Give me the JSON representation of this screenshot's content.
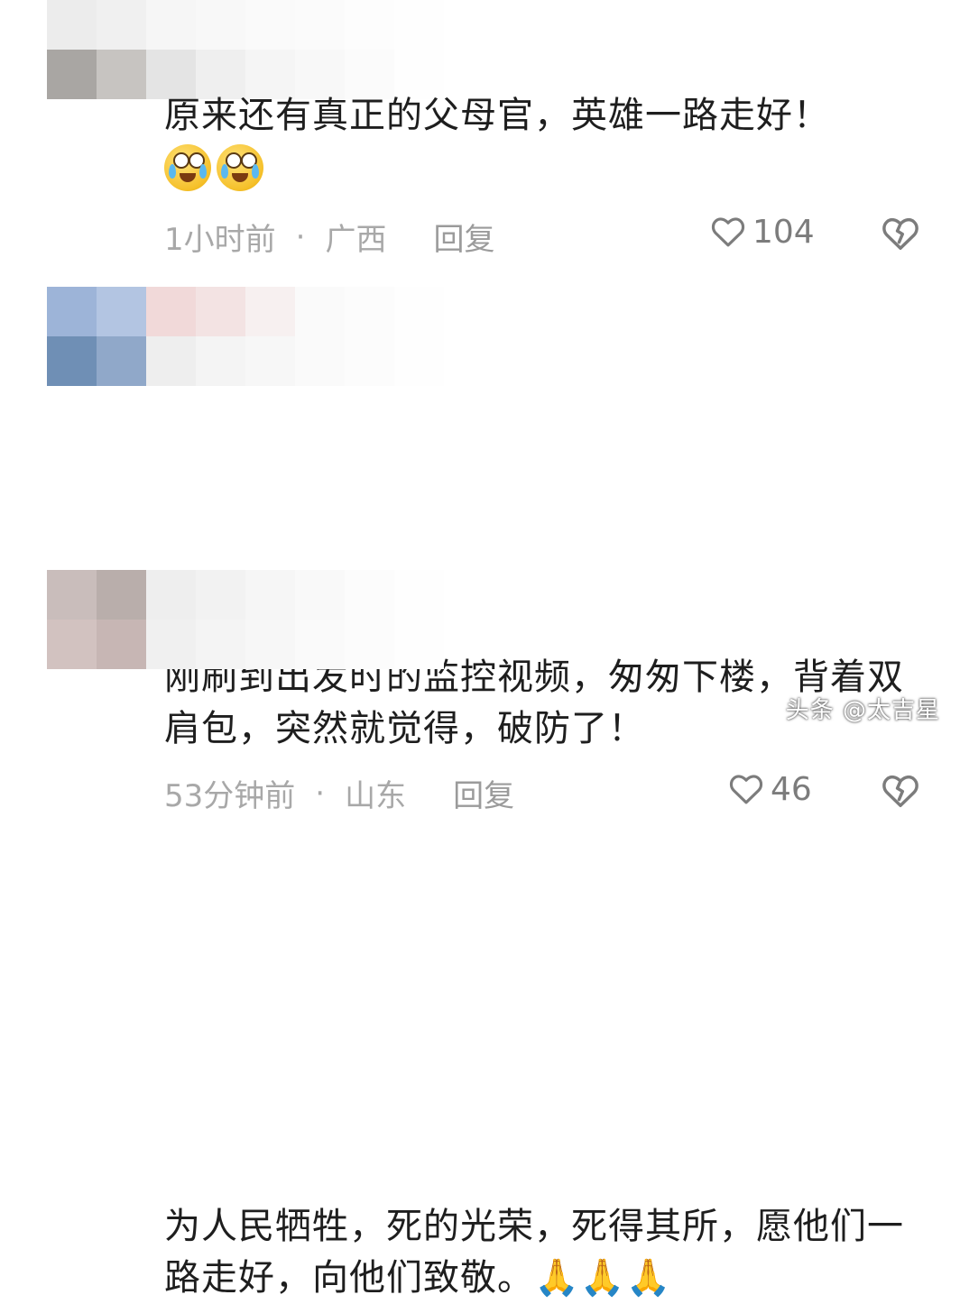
{
  "comments": [
    {
      "text": "原来还有真正的父母官，英雄一路走好！",
      "emoji": [
        "crying-laughing-face",
        "crying-laughing-face"
      ],
      "time": "1小时前",
      "separator": "·",
      "location": "广西",
      "reply_label": "回复",
      "likes": "104"
    },
    {
      "text": "刚刷到出发时的监控视频，匆匆下楼，背着双肩包，突然就觉得，破防了！",
      "time": "53分钟前",
      "separator": "·",
      "location": "山东",
      "reply_label": "回复",
      "likes": "46"
    },
    {
      "text": "为人民牺牲，死的光荣，死得其所，愿他们一路走好，向他们致敬。",
      "emoji": [
        "folded-hands",
        "folded-hands",
        "folded-hands"
      ]
    }
  ],
  "watermark": "头条 @太吉星",
  "colors": {
    "text": "#1e1e1e",
    "meta": "#a8a8a8",
    "icon": "#7c7c7c"
  }
}
